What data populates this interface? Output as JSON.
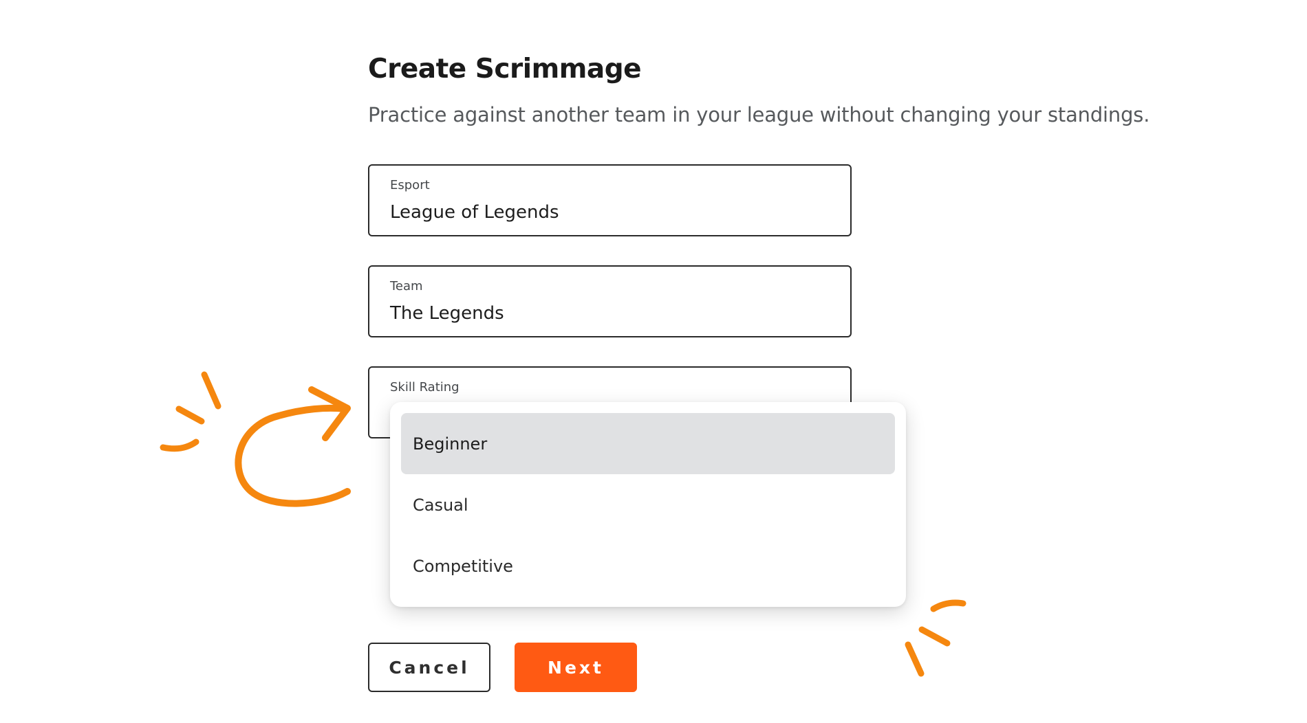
{
  "page": {
    "title": "Create Scrimmage",
    "subtitle": "Practice against another team in your league without changing your standings."
  },
  "form": {
    "esport": {
      "label": "Esport",
      "value": "League of Legends"
    },
    "team": {
      "label": "Team",
      "value": "The Legends"
    },
    "skill_rating": {
      "label": "Skill Rating",
      "options": [
        "Beginner",
        "Casual",
        "Competitive"
      ],
      "highlighted_option": "Beginner"
    }
  },
  "actions": {
    "cancel_label": "Cancel",
    "next_label": "Next"
  },
  "colors": {
    "accent": "#ff5a13",
    "doodle": "#f5870f",
    "option_highlight": "#e0e1e3",
    "border": "#2a2a2a"
  },
  "icons": [
    "curved-arrow-doodle-icon",
    "sparkle-lines-left-icon",
    "sparkle-lines-right-icon"
  ]
}
